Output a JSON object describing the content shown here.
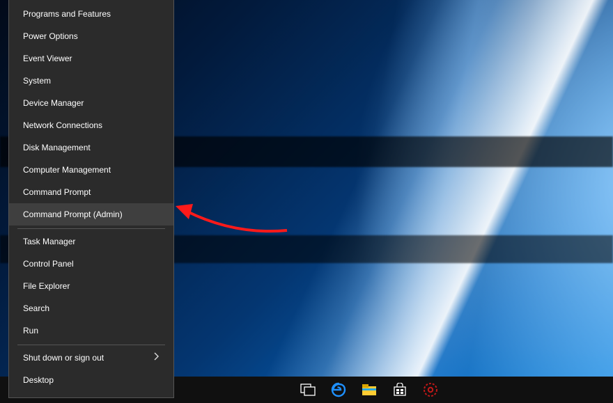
{
  "menu": {
    "group1": [
      {
        "label": "Programs and Features"
      },
      {
        "label": "Power Options"
      },
      {
        "label": "Event Viewer"
      },
      {
        "label": "System"
      },
      {
        "label": "Device Manager"
      },
      {
        "label": "Network Connections"
      },
      {
        "label": "Disk Management"
      },
      {
        "label": "Computer Management"
      },
      {
        "label": "Command Prompt"
      },
      {
        "label": "Command Prompt (Admin)",
        "highlight": true
      }
    ],
    "group2": [
      {
        "label": "Task Manager"
      },
      {
        "label": "Control Panel"
      },
      {
        "label": "File Explorer"
      },
      {
        "label": "Search"
      },
      {
        "label": "Run"
      }
    ],
    "group3": [
      {
        "label": "Shut down or sign out",
        "submenu": true
      },
      {
        "label": "Desktop"
      }
    ]
  },
  "taskbar": {
    "icons": [
      {
        "name": "task-view-icon"
      },
      {
        "name": "edge-icon"
      },
      {
        "name": "file-explorer-icon"
      },
      {
        "name": "store-icon"
      },
      {
        "name": "gear-red-icon"
      }
    ]
  },
  "annotation": {
    "type": "arrow",
    "color": "#ff1a1a",
    "target": "Command Prompt (Admin)"
  }
}
